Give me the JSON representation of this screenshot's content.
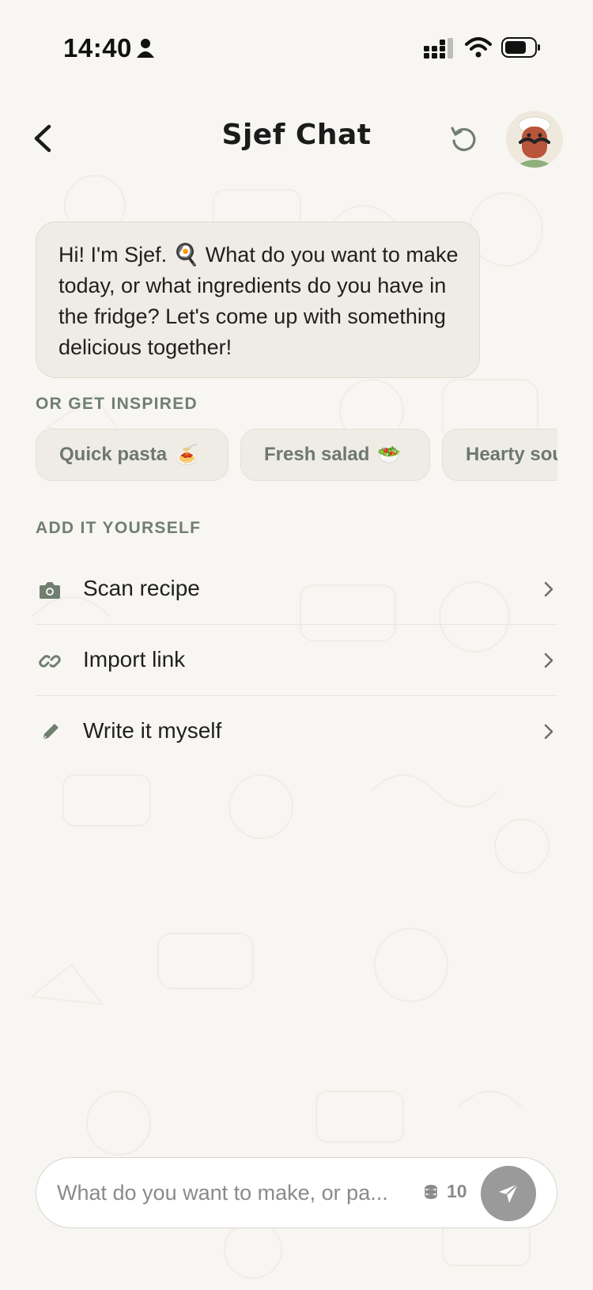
{
  "status_bar": {
    "time": "14:40",
    "icons": [
      "person-icon",
      "signal-icon",
      "wifi-icon",
      "battery-icon"
    ]
  },
  "header": {
    "back_icon": "chevron-left-icon",
    "title": "Sjef Chat",
    "reset_icon": "refresh-icon",
    "avatar_icon": "chef-avatar"
  },
  "chat": {
    "message": "Hi! I'm Sjef. 🍳 What do you want to make today, or what ingredients do you have in the fridge? Let's come up with something delicious together!"
  },
  "inspire": {
    "label": "OR GET INSPIRED",
    "chips": [
      {
        "label": "Quick pasta",
        "emoji": "🍝"
      },
      {
        "label": "Fresh salad",
        "emoji": "🥗"
      },
      {
        "label": "Hearty soup",
        "emoji": ""
      }
    ]
  },
  "add_yourself": {
    "label": "ADD IT YOURSELF",
    "items": [
      {
        "label": "Scan recipe",
        "icon": "camera-icon"
      },
      {
        "label": "Import link",
        "icon": "link-icon"
      },
      {
        "label": "Write it myself",
        "icon": "pen-icon"
      }
    ]
  },
  "composer": {
    "placeholder": "What do you want to make, or pa...",
    "credits": "10",
    "coins_icon": "coins-icon",
    "send_icon": "send-icon"
  },
  "colors": {
    "background": "#f8f6f2",
    "bubble": "#efece6",
    "accent_green": "#6f7f70",
    "send_button": "#9a9a9a"
  }
}
